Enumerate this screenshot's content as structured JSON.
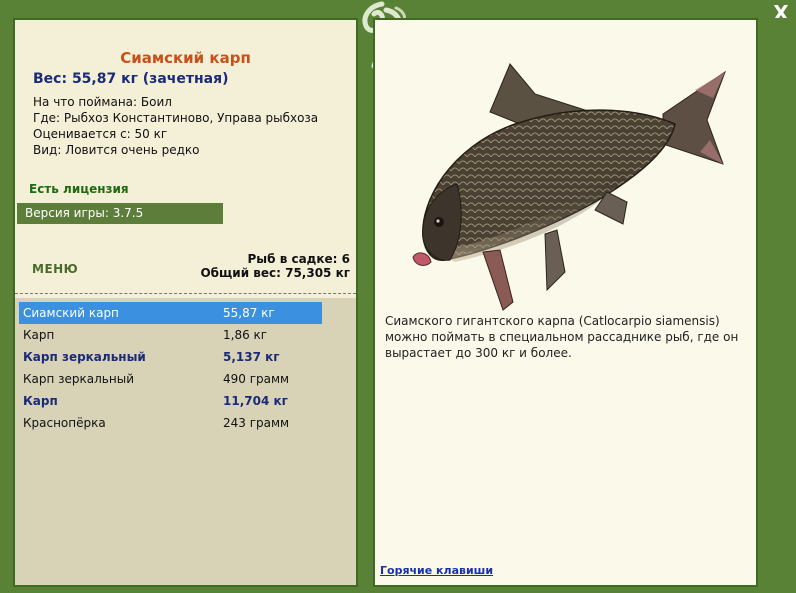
{
  "window": {
    "close_label": "X"
  },
  "fish": {
    "name": "Сиамский карп",
    "weight_line": "Вес: 55,87 кг (зачетная)",
    "info_lines": [
      "На что поймана: Боил",
      "Где: Рыбхоз Константиново, Управа рыбхоза",
      "Оценивается с: 50 кг",
      "Вид: Ловится очень редко"
    ]
  },
  "license": "Есть лицензия",
  "version": "Версия игры: 3.7.5",
  "menu_label": "МЕНЮ",
  "stats": {
    "count_line": "Рыб в садке: 6",
    "total_line": "Общий вес: 75,305 кг"
  },
  "catch_list": [
    {
      "name": "Сиамский карп",
      "weight": "55,87 кг",
      "state": "selected"
    },
    {
      "name": "Карп",
      "weight": "1,86 кг",
      "state": "normal"
    },
    {
      "name": "Карп зеркальный",
      "weight": "5,137 кг",
      "state": "bold"
    },
    {
      "name": "Карп зеркальный",
      "weight": "490 грамм",
      "state": "normal"
    },
    {
      "name": "Карп",
      "weight": "11,704 кг",
      "state": "bold"
    },
    {
      "name": "Краснопёрка",
      "weight": "243 грамм",
      "state": "normal"
    }
  ],
  "description": "Сиамского гигантского карпа (Catlocarpio siamensis) можно поймать в специальном рассаднике рыб, где он вырастает до 300 кг и более.",
  "hotkeys_label": "Горячие клавиши",
  "colors": {
    "frame": "#5a8236",
    "selected_row": "#3b91e0",
    "title": "#c8501a",
    "weight": "#1c2a7a",
    "license": "#1e6a12"
  }
}
